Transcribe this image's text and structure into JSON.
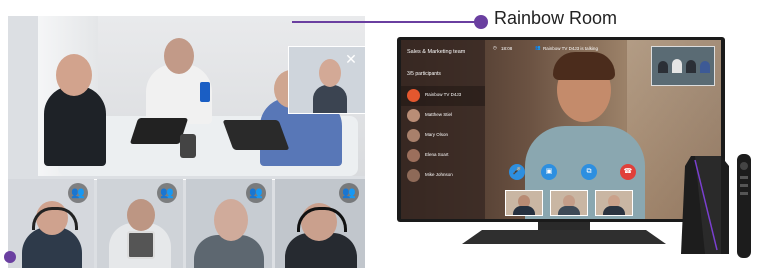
{
  "callout": {
    "label": "Rainbow Room",
    "color": "#6a3fa0"
  },
  "conference": {
    "pip_close_icon": "close-icon",
    "tile_badge_icon": "add-people-icon",
    "tiles": [
      {
        "name": "participant-tile-1"
      },
      {
        "name": "participant-tile-2"
      },
      {
        "name": "participant-tile-3"
      },
      {
        "name": "participant-tile-4"
      }
    ]
  },
  "tv": {
    "sidebar": {
      "title": "Sales & Marketing team",
      "participant_count": "3/5 participants",
      "participants": [
        {
          "name": "Rainbow TV D4J3",
          "active": true
        },
        {
          "name": "Matthew Stiel"
        },
        {
          "name": "Mary Olson"
        },
        {
          "name": "Elena Soart"
        },
        {
          "name": "Mike Johnson"
        }
      ]
    },
    "topbar": {
      "time": "18:08",
      "status": "Rainbow TV D4J3 is talking"
    },
    "controls": [
      {
        "icon": "microphone-icon",
        "color": "#2d8fe0"
      },
      {
        "icon": "camera-icon",
        "color": "#2d8fe0"
      },
      {
        "icon": "screen-share-icon",
        "color": "#2d8fe0"
      },
      {
        "icon": "hang-up-icon",
        "color": "#e0403a"
      }
    ]
  }
}
